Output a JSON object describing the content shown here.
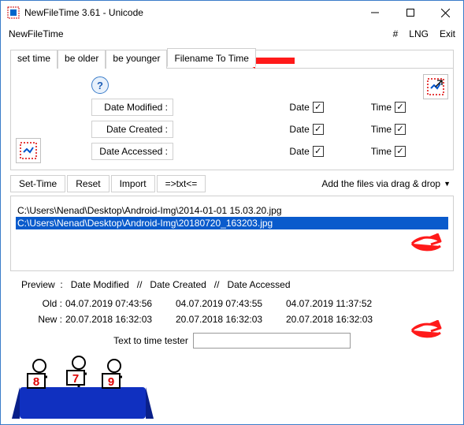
{
  "titlebar": {
    "title": "NewFileTime 3.61 - Unicode"
  },
  "menubar": {
    "left": "NewFileTime",
    "right": {
      "hash": "#",
      "lng": "LNG",
      "exit": "Exit"
    }
  },
  "tabs": {
    "set_time": "set time",
    "be_older": "be older",
    "be_younger": "be younger",
    "filename_to_time": "Filename To Time"
  },
  "date_section": {
    "rows": [
      {
        "label": "Date Modified :",
        "date": "Date",
        "time": "Time",
        "date_checked": true,
        "time_checked": true
      },
      {
        "label": "Date Created :",
        "date": "Date",
        "time": "Time",
        "date_checked": true,
        "time_checked": true
      },
      {
        "label": "Date Accessed :",
        "date": "Date",
        "time": "Time",
        "date_checked": true,
        "time_checked": true
      }
    ]
  },
  "toolbar": {
    "set_time": "Set-Time",
    "reset": "Reset",
    "import": "Import",
    "txt": "=>txt<=",
    "drag_drop": "Add the files via drag & drop"
  },
  "filelist": {
    "items": [
      {
        "path": "C:\\Users\\Nenad\\Desktop\\Android-Img\\2014-01-01 15.03.20.jpg",
        "selected": false
      },
      {
        "path": "C:\\Users\\Nenad\\Desktop\\Android-Img\\20180720_163203.jpg",
        "selected": true
      }
    ]
  },
  "preview": {
    "header": {
      "preview": "Preview  :",
      "mod": "Date Modified",
      "cre": "Date Created",
      "acc": "Date Accessed",
      "sep": "   //   "
    },
    "rows": [
      {
        "label": "Old :",
        "mod": "04.07.2019 07:43:56",
        "cre": "04.07.2019 07:43:55",
        "acc": "04.07.2019 11:37:52"
      },
      {
        "label": "New :",
        "mod": "20.07.2018 16:32:03",
        "cre": "20.07.2018 16:32:03",
        "acc": "20.07.2018 16:32:03"
      }
    ]
  },
  "tester": {
    "label": "Text to time tester",
    "value": ""
  },
  "help_glyph": "?",
  "check_glyph": "✓"
}
